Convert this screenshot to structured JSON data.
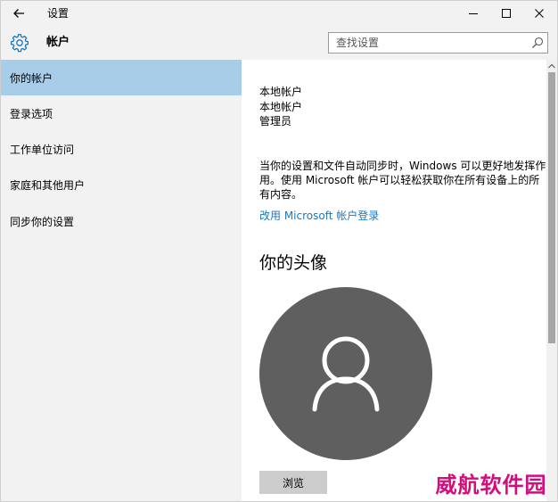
{
  "window": {
    "title": "设置"
  },
  "header": {
    "title": "帐户",
    "search_placeholder": "查找设置"
  },
  "sidebar": {
    "items": [
      {
        "label": "你的帐户",
        "selected": true
      },
      {
        "label": "登录选项",
        "selected": false
      },
      {
        "label": "工作单位访问",
        "selected": false
      },
      {
        "label": "家庭和其他用户",
        "selected": false
      },
      {
        "label": "同步你的设置",
        "selected": false
      }
    ]
  },
  "account": {
    "name": "本地帐户",
    "type": "本地帐户",
    "role": "管理员"
  },
  "description": "当你的设置和文件自动同步时，Windows 可以更好地发挥作用。使用 Microsoft 帐户可以轻松获取你在所有设备上的所有内容。",
  "ms_link": "改用 Microsoft 帐户登录",
  "avatar_section": {
    "heading": "你的头像",
    "browse_label": "浏览"
  },
  "watermark": "威航软件园",
  "colors": {
    "sidebar_bg": "#f2f2f2",
    "selected_bg": "#a8cde8",
    "link": "#1878c0",
    "avatar_bg": "#5f5f5f",
    "watermark": "#d40c7c"
  },
  "icons": {
    "back": "arrow-left-icon",
    "minimize": "minimize-icon",
    "maximize": "maximize-icon",
    "close": "close-icon",
    "gear": "gear-icon",
    "search": "search-icon",
    "avatar": "user-silhouette-icon"
  }
}
